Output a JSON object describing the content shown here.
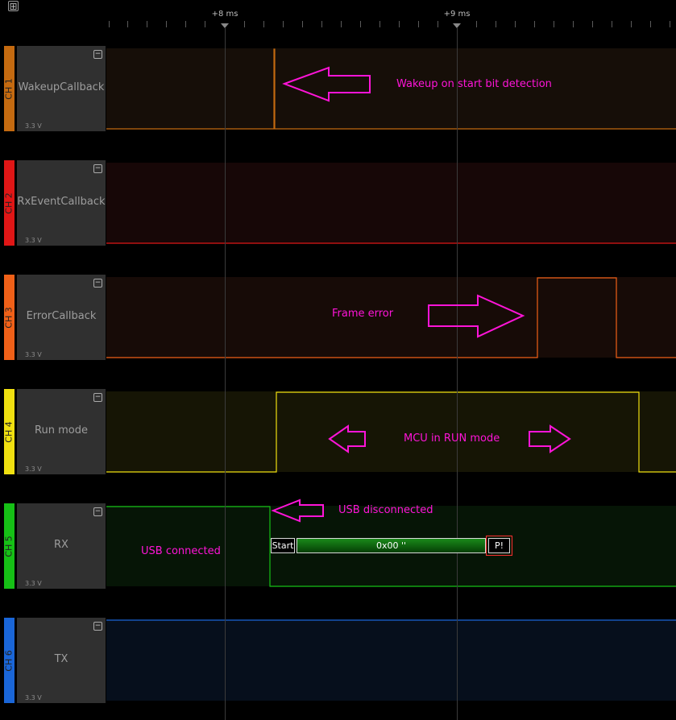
{
  "timeline": {
    "add_symbol": "⊞",
    "markers": [
      "+8 ms",
      "+9 ms"
    ]
  },
  "channels": [
    {
      "num": "CH 1",
      "name": "WakeupCallback",
      "voltage": "3.3 V",
      "color": "#c46a10",
      "collapse": "−"
    },
    {
      "num": "CH 2",
      "name": "RxEventCallback",
      "voltage": "3.3 V",
      "color": "#e01616",
      "collapse": "−"
    },
    {
      "num": "CH 3",
      "name": "ErrorCallback",
      "voltage": "3.3 V",
      "color": "#f06018",
      "collapse": "−"
    },
    {
      "num": "CH 4",
      "name": "Run mode",
      "voltage": "3.3 V",
      "color": "#f0e010",
      "collapse": "−"
    },
    {
      "num": "CH 5",
      "name": "RX",
      "voltage": "3.3 V",
      "color": "#16c016",
      "collapse": "−"
    },
    {
      "num": "CH 6",
      "name": "TX",
      "voltage": "3.3 V",
      "color": "#1a66d8",
      "collapse": "−"
    }
  ],
  "annotations": {
    "wakeup": "Wakeup on start bit detection",
    "frame_error": "Frame error",
    "run_mode": "MCU in RUN mode",
    "usb_disconnected": "USB disconnected",
    "usb_connected": "USB connected"
  },
  "decoder": {
    "start": "Start",
    "data": "0x00 ''",
    "error": "P!"
  },
  "colors": {
    "annotation": "#ff14d8",
    "decoder_fill": "#0b6a0b"
  }
}
